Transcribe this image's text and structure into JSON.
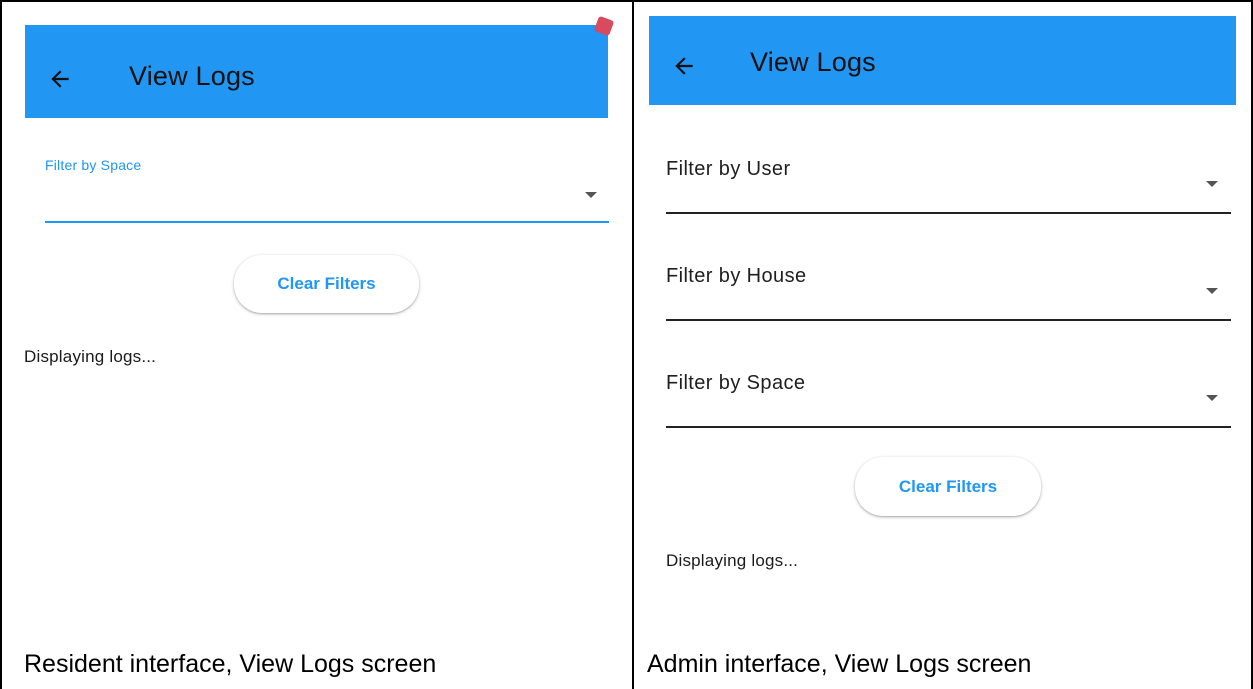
{
  "resident": {
    "appbar": {
      "title": "View Logs",
      "back_icon": "arrow-left-icon"
    },
    "filters": [
      {
        "label": "Filter by Space",
        "value": ""
      }
    ],
    "clear_button_label": "Clear Filters",
    "status_text": "Displaying logs...",
    "caption": "Resident interface, View Logs screen"
  },
  "admin": {
    "appbar": {
      "title": "View Logs",
      "back_icon": "arrow-left-icon"
    },
    "filters": [
      {
        "label": "Filter by User",
        "value": ""
      },
      {
        "label": "Filter by House",
        "value": ""
      },
      {
        "label": "Filter by Space",
        "value": ""
      }
    ],
    "clear_button_label": "Clear Filters",
    "status_text": "Displaying logs...",
    "caption": "Admin interface, View Logs screen"
  },
  "colors": {
    "appbar": "#2196f3",
    "accent": "#2196f3",
    "text": "#1f1f1f"
  }
}
